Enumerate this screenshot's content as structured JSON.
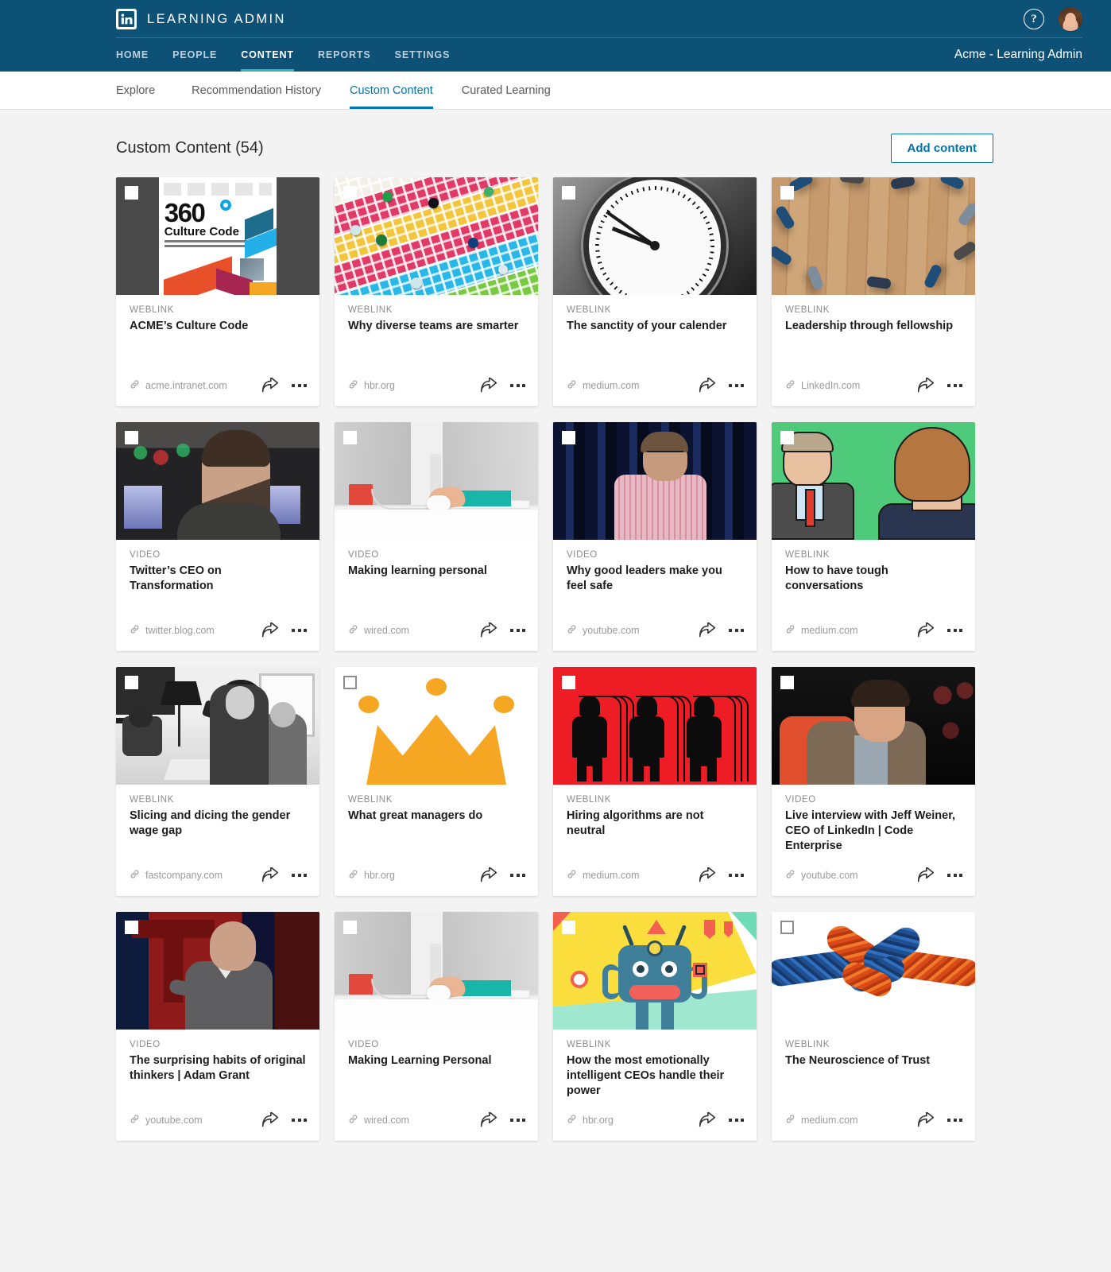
{
  "brand": {
    "logo_icon": "linkedin-logo-icon",
    "title": "LEARNING ADMIN",
    "help_icon": "help-circle-icon",
    "help_label": "?",
    "avatar_icon": "user-avatar",
    "org_label": "Acme - Learning Admin"
  },
  "nav": {
    "items": [
      {
        "label": "HOME",
        "active": false
      },
      {
        "label": "PEOPLE",
        "active": false
      },
      {
        "label": "CONTENT",
        "active": true
      },
      {
        "label": "REPORTS",
        "active": false
      },
      {
        "label": "SETTINGS",
        "active": false
      }
    ]
  },
  "subtabs": {
    "items": [
      {
        "label": "Explore",
        "active": false
      },
      {
        "label": "Recommendation History",
        "active": false
      },
      {
        "label": "Custom Content",
        "active": true
      },
      {
        "label": "Curated Learning",
        "active": false
      }
    ]
  },
  "page": {
    "title": "Custom Content (54)",
    "add_button": "Add content",
    "accent_color": "#0073b1",
    "brand_bar_color": "#0e5176",
    "active_nav_underline_color": "#38b2ac"
  },
  "card_icons": {
    "link_icon": "link-chain-icon",
    "share_icon": "share-arrow-icon",
    "more_icon": "more-horizontal-icon",
    "checkbox_icon": "checkbox-unchecked-icon"
  },
  "cards": [
    {
      "kind": "WEBLINK",
      "title": "ACME’s Culture Code",
      "source": "acme.intranet.com",
      "art": "t-culture",
      "light_checkbox": false
    },
    {
      "kind": "WEBLINK",
      "title": "Why diverse teams are smarter",
      "source": "hbr.org",
      "art": "t-bingo",
      "light_checkbox": false
    },
    {
      "kind": "WEBLINK",
      "title": "The sanctity of your calender",
      "source": "medium.com",
      "art": "t-clock",
      "light_checkbox": false
    },
    {
      "kind": "WEBLINK",
      "title": "Leadership through fellowship",
      "source": "LinkedIn.com",
      "art": "t-wood",
      "light_checkbox": false
    },
    {
      "kind": "VIDEO",
      "title": "Twitter’s CEO on Transformation",
      "source": "twitter.blog.com",
      "art": "t-jack",
      "light_checkbox": false
    },
    {
      "kind": "VIDEO",
      "title": "Making learning personal",
      "source": "wired.com",
      "art": "t-desk",
      "light_checkbox": false
    },
    {
      "kind": "VIDEO",
      "title": "Why good leaders make you feel safe",
      "source": "youtube.com",
      "art": "t-simon",
      "light_checkbox": false
    },
    {
      "kind": "WEBLINK",
      "title": "How to have tough conversations",
      "source": "medium.com",
      "art": "t-toon",
      "light_checkbox": false
    },
    {
      "kind": "WEBLINK",
      "title": "Slicing and dicing the gender wage gap",
      "source": "fastcompany.com",
      "art": "t-office",
      "light_checkbox": false
    },
    {
      "kind": "WEBLINK",
      "title": "What great managers do",
      "source": "hbr.org",
      "art": "t-crown",
      "light_checkbox": true
    },
    {
      "kind": "WEBLINK",
      "title": "Hiring algorithms are not neutral",
      "source": "medium.com",
      "art": "t-hiring",
      "light_checkbox": false
    },
    {
      "kind": "VIDEO",
      "title": "Live interview with Jeff Weiner, CEO of LinkedIn | Code Enterprise",
      "source": "youtube.com",
      "art": "t-weiner",
      "light_checkbox": false
    },
    {
      "kind": "VIDEO",
      "title": "The surprising habits of original thinkers | Adam Grant",
      "source": "youtube.com",
      "art": "t-adam",
      "light_checkbox": false
    },
    {
      "kind": "VIDEO",
      "title": "Making Learning Personal",
      "source": "wired.com",
      "art": "t-desk",
      "light_checkbox": false
    },
    {
      "kind": "WEBLINK",
      "title": "How the most emotionally intelligent CEOs handle their power",
      "source": "hbr.org",
      "art": "t-monster",
      "light_checkbox": false
    },
    {
      "kind": "WEBLINK",
      "title": "The Neuroscience of Trust",
      "source": "medium.com",
      "art": "t-knot",
      "light_checkbox": true
    }
  ]
}
